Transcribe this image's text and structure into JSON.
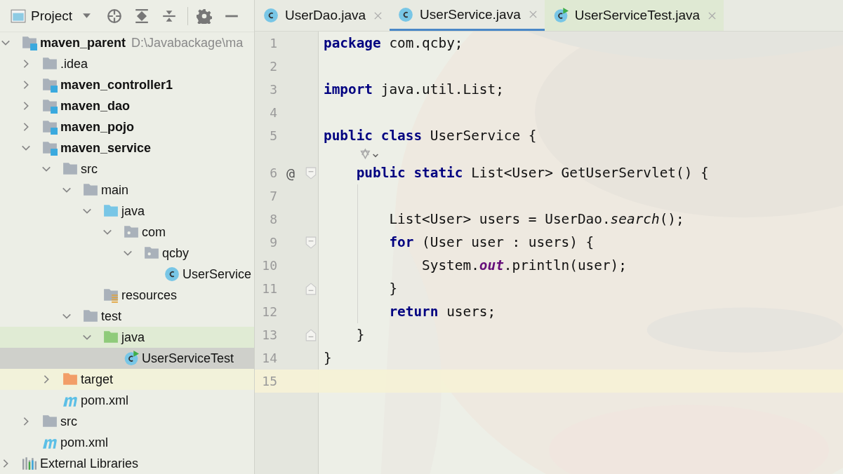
{
  "project_panel": {
    "title": "Project",
    "tree": [
      {
        "label": "maven_parent",
        "path": "D:\\Javabackage\\ma",
        "kind": "module",
        "bold": true,
        "expanded": true,
        "selected": false,
        "children": [
          {
            "label": ".idea",
            "kind": "folder",
            "bold": false,
            "expanded": false,
            "selected": false
          },
          {
            "label": "maven_controller1",
            "kind": "module",
            "bold": true,
            "expanded": false,
            "selected": false
          },
          {
            "label": "maven_dao",
            "kind": "module",
            "bold": true,
            "expanded": false,
            "selected": false
          },
          {
            "label": "maven_pojo",
            "kind": "module",
            "bold": true,
            "expanded": false,
            "selected": false
          },
          {
            "label": "maven_service",
            "kind": "module",
            "bold": true,
            "expanded": true,
            "selected": false,
            "children": [
              {
                "label": "src",
                "kind": "folder",
                "bold": false,
                "expanded": true,
                "selected": false,
                "children": [
                  {
                    "label": "main",
                    "kind": "folder",
                    "bold": false,
                    "expanded": true,
                    "selected": false,
                    "children": [
                      {
                        "label": "java",
                        "kind": "source-folder",
                        "bold": false,
                        "expanded": true,
                        "selected": false,
                        "children": [
                          {
                            "label": "com",
                            "kind": "package",
                            "bold": false,
                            "expanded": true,
                            "selected": false,
                            "children": [
                              {
                                "label": "qcby",
                                "kind": "package",
                                "bold": false,
                                "expanded": true,
                                "selected": false,
                                "children": [
                                  {
                                    "label": "UserService",
                                    "kind": "class",
                                    "bold": false,
                                    "selected": false
                                  }
                                ]
                              }
                            ]
                          }
                        ]
                      },
                      {
                        "label": "resources",
                        "kind": "resources",
                        "bold": false,
                        "selected": false
                      }
                    ]
                  },
                  {
                    "label": "test",
                    "kind": "folder",
                    "bold": false,
                    "expanded": true,
                    "selected": false,
                    "children": [
                      {
                        "label": "java",
                        "kind": "test-folder",
                        "bold": false,
                        "expanded": true,
                        "selected": false,
                        "color": "#e0ebd4",
                        "children": [
                          {
                            "label": "UserServiceTest",
                            "kind": "test-class",
                            "bold": false,
                            "selected": true
                          }
                        ]
                      }
                    ]
                  }
                ]
              },
              {
                "label": "target",
                "kind": "excluded-folder",
                "bold": false,
                "expanded": false,
                "selected": false,
                "color": "#f2f2da"
              },
              {
                "label": "pom.xml",
                "kind": "maven",
                "bold": false,
                "selected": false
              }
            ]
          },
          {
            "label": "src",
            "kind": "folder",
            "bold": false,
            "expanded": false,
            "selected": false
          },
          {
            "label": "pom.xml",
            "kind": "maven",
            "bold": false,
            "selected": false
          }
        ]
      },
      {
        "label": "External Libraries",
        "kind": "libraries",
        "bold": false,
        "expanded": false,
        "selected": false
      }
    ]
  },
  "editor": {
    "tabs": [
      {
        "label": "UserDao.java",
        "kind": "class",
        "selected": false
      },
      {
        "label": "UserService.java",
        "kind": "class",
        "selected": true
      },
      {
        "label": "UserServiceTest.java",
        "kind": "test-class",
        "selected": false
      }
    ],
    "lines": [
      {
        "kind": "code",
        "number": "1",
        "tokens": [
          {
            "text": "package",
            "kind": "keyword"
          },
          {
            "text": " com.qcby;",
            "kind": "plain"
          }
        ]
      },
      {
        "kind": "code",
        "number": "2"
      },
      {
        "kind": "code",
        "number": "3",
        "tokens": [
          {
            "text": "import",
            "kind": "keyword"
          },
          {
            "text": " java.util.List;",
            "kind": "plain"
          }
        ]
      },
      {
        "kind": "code",
        "number": "4"
      },
      {
        "kind": "code",
        "number": "5",
        "tokens": [
          {
            "text": "public class",
            "kind": "keyword"
          },
          {
            "text": " UserService {",
            "kind": "plain"
          }
        ]
      },
      {
        "kind": "hint"
      },
      {
        "kind": "code",
        "number": "6",
        "marker": "@",
        "fold_start": true,
        "tokens": [
          {
            "text": "    public static",
            "kind": "keyword"
          },
          {
            "text": " List<User> GetUserServlet() {",
            "kind": "plain"
          }
        ]
      },
      {
        "kind": "code",
        "number": "7",
        "guide": true
      },
      {
        "kind": "code",
        "number": "8",
        "guide": true,
        "tokens": [
          {
            "text": "        List<User> users = UserDao.",
            "kind": "plain"
          },
          {
            "text": "search",
            "kind": "method"
          },
          {
            "text": "();",
            "kind": "plain"
          }
        ]
      },
      {
        "kind": "code",
        "number": "9",
        "guide": true,
        "fold_start": true,
        "tokens": [
          {
            "text": "        for",
            "kind": "keyword"
          },
          {
            "text": " (User user : users) {",
            "kind": "plain"
          }
        ]
      },
      {
        "kind": "code",
        "number": "10",
        "guide": true,
        "tokens": [
          {
            "text": "            System.",
            "kind": "plain"
          },
          {
            "text": "out",
            "kind": "static-field"
          },
          {
            "text": ".println(user);",
            "kind": "plain"
          }
        ]
      },
      {
        "kind": "code",
        "number": "11",
        "guide": true,
        "fold_end": true,
        "tokens": [
          {
            "text": "        }",
            "kind": "plain"
          }
        ]
      },
      {
        "kind": "code",
        "number": "12",
        "guide": true,
        "tokens": [
          {
            "text": "        return",
            "kind": "keyword"
          },
          {
            "text": " users;",
            "kind": "plain"
          }
        ]
      },
      {
        "kind": "code",
        "number": "13",
        "fold_end": true,
        "tokens": [
          {
            "text": "    }",
            "kind": "plain"
          }
        ]
      },
      {
        "kind": "code",
        "number": "14",
        "tokens": [
          {
            "text": "}",
            "kind": "plain"
          }
        ]
      },
      {
        "kind": "code",
        "number": "15",
        "current": true
      }
    ]
  }
}
